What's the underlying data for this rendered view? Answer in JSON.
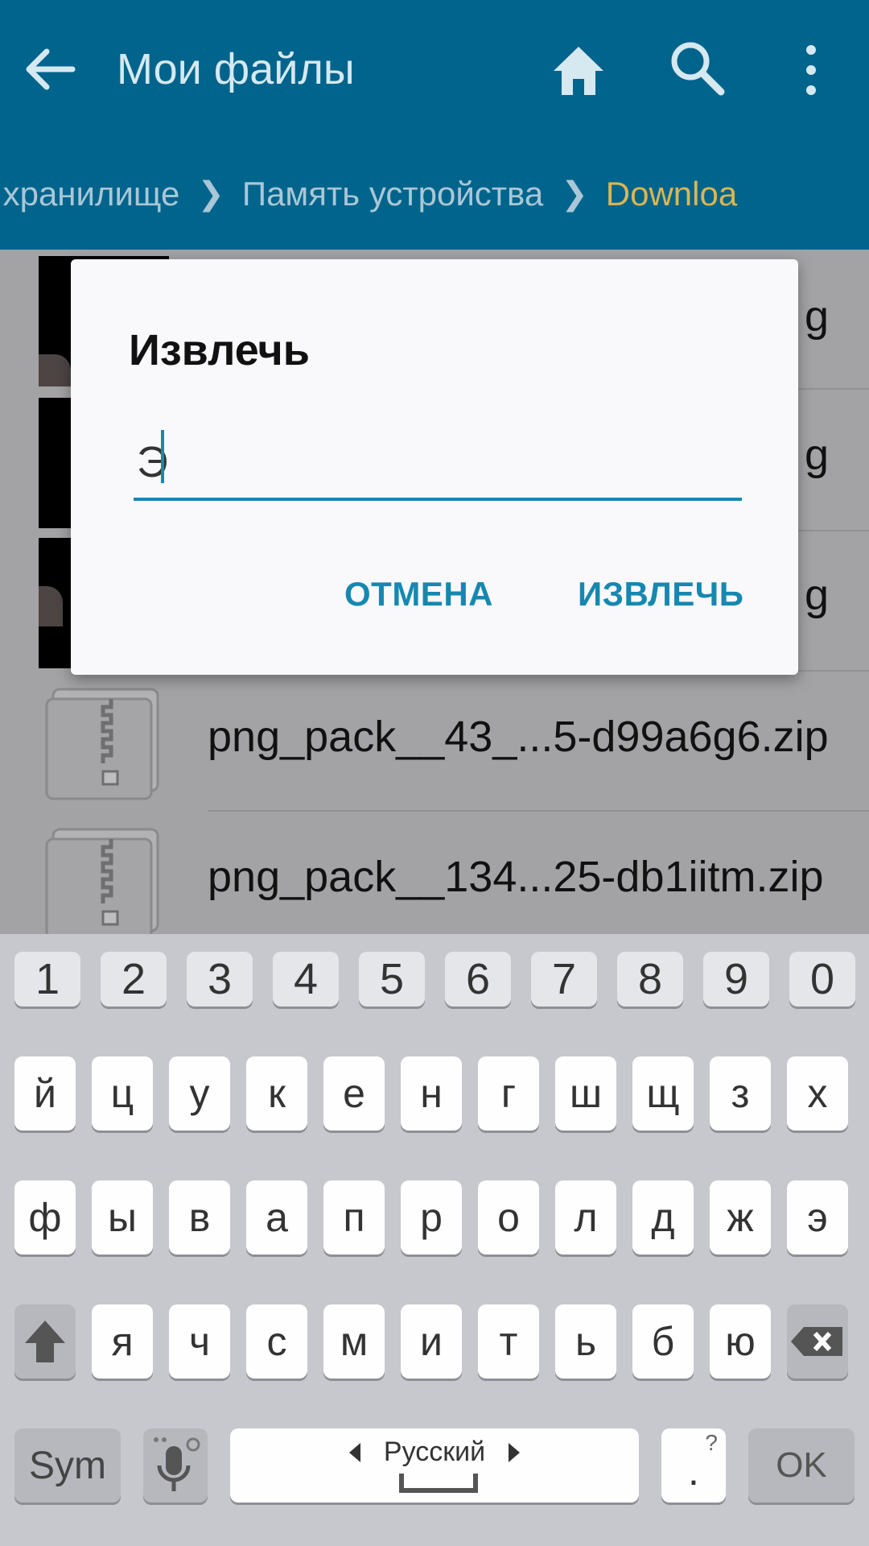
{
  "appbar": {
    "title": "Мои файлы",
    "icons": {
      "back": "arrow-left-icon",
      "home": "home-icon",
      "search": "search-icon",
      "more": "more-vert-icon"
    }
  },
  "breadcrumbs": [
    "ное хранилище",
    "Память устройства",
    "Downloa"
  ],
  "list": [
    {
      "type": "image",
      "name_tail": "g"
    },
    {
      "type": "image",
      "name_tail": "g"
    },
    {
      "type": "image",
      "name_tail": "g"
    },
    {
      "type": "zip",
      "name": "png_pack__43_...5-d99a6g6.zip"
    },
    {
      "type": "zip",
      "name": "png_pack__134...25-db1iitm.zip"
    }
  ],
  "dialog": {
    "title": "Извлечь",
    "input_value": "Э",
    "cancel_label": "ОТМЕНА",
    "extract_label": "ИЗВЛЕЧЬ"
  },
  "keyboard": {
    "numbers": [
      "1",
      "2",
      "3",
      "4",
      "5",
      "6",
      "7",
      "8",
      "9",
      "0"
    ],
    "row1": [
      "й",
      "ц",
      "у",
      "к",
      "е",
      "н",
      "г",
      "ш",
      "щ",
      "з",
      "х"
    ],
    "row2": [
      "ф",
      "ы",
      "в",
      "а",
      "п",
      "р",
      "о",
      "л",
      "д",
      "ж",
      "э"
    ],
    "row3": [
      "я",
      "ч",
      "с",
      "м",
      "и",
      "т",
      "ь",
      "б",
      "ю"
    ],
    "sym_label": "Sym",
    "language": "Русский",
    "period": ".",
    "period_hint": "?",
    "ok_label": "OK"
  },
  "colors": {
    "appbar": "#00648c",
    "accent": "#1688b0",
    "breadcrumb_current": "#d9b653"
  }
}
